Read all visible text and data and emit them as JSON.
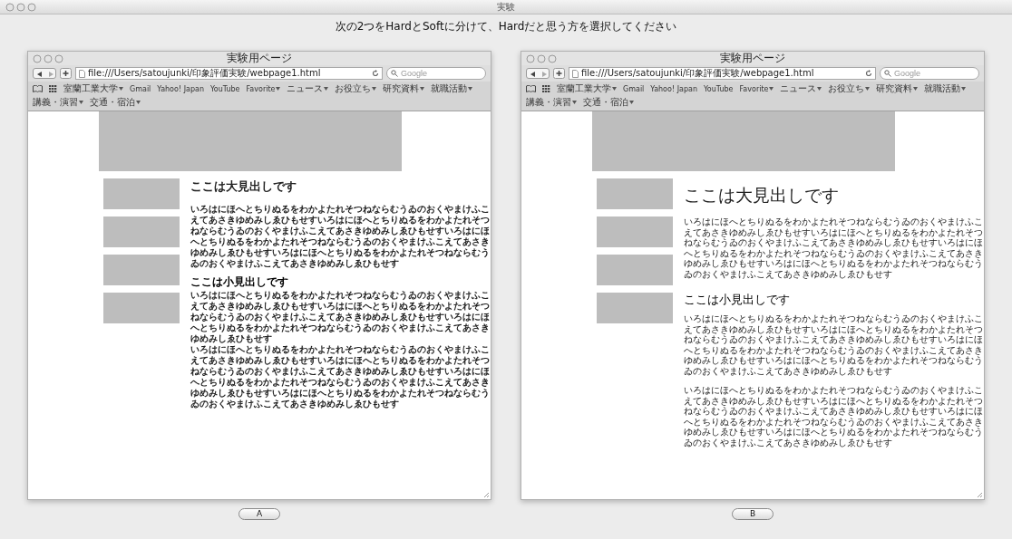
{
  "window": {
    "title": "実験"
  },
  "instruction": "次の2つをHardとSoftに分けて、Hardだと思う方を選択してください",
  "panes": [
    {
      "browser": {
        "title": "実験用ページ",
        "url": "file:///Users/satoujunki/印象評価実験/webpage1.html",
        "search": {
          "placeholder": "Google"
        },
        "bookmarks": [
          {
            "label": "室蘭工業大学",
            "menu": true
          },
          {
            "label": "Gmail",
            "menu": false
          },
          {
            "label": "Yahoo! Japan",
            "menu": false
          },
          {
            "label": "YouTube",
            "menu": false
          },
          {
            "label": "Favorite",
            "menu": true
          },
          {
            "label": "ニュース",
            "menu": true
          },
          {
            "label": "お役立ち",
            "menu": true
          },
          {
            "label": "研究資料",
            "menu": true
          },
          {
            "label": "就職活動",
            "menu": true
          },
          {
            "label": "講義・演習",
            "menu": true
          },
          {
            "label": "交通・宿泊",
            "menu": true
          }
        ]
      },
      "page": {
        "kind": "gothic",
        "blocks": [
          {
            "kind": "heading",
            "text": "ここは大見出しです"
          },
          {
            "kind": "paragraph",
            "text": "いろはにほへとちりぬるをわかよたれそつねならむうゐのおくやまけふこえてあさきゆめみしゑひもせすいろはにほへとちりぬるをわかよたれそつねならむうゐのおくやまけふこえてあさきゆめみしゑひもせすいろはにほへとちりぬるをわかよたれそつねならむうゐのおくやまけふこえてあさきゆめみしゑひもせすいろはにほへとちりぬるをわかよたれそつねならむうゐのおくやまけふこえてあさきゆめみしゑひもせす"
          },
          {
            "kind": "subheading",
            "text": "ここは小見出しです"
          },
          {
            "kind": "paragraph",
            "text": "いろはにほへとちりぬるをわかよたれそつねならむうゐのおくやまけふこえてあさきゆめみしゑひもせすいろはにほへとちりぬるをわかよたれそつねならむうゐのおくやまけふこえてあさきゆめみしゑひもせすいろはにほへとちりぬるをわかよたれそつねならむうゐのおくやまけふこえてあさきゆめみしゑひもせす"
          },
          {
            "kind": "paragraph",
            "text": "いろはにほへとちりぬるをわかよたれそつねならむうゐのおくやまけふこえてあさきゆめみしゑひもせすいろはにほへとちりぬるをわかよたれそつねならむうゐのおくやまけふこえてあさきゆめみしゑひもせすいろはにほへとちりぬるをわかよたれそつねならむうゐのおくやまけふこえてあさきゆめみしゑひもせすいろはにほへとちりぬるをわかよたれそつねならむうゐのおくやまけふこえてあさきゆめみしゑひもせす"
          }
        ]
      },
      "button": "A"
    },
    {
      "browser": {
        "title": "実験用ページ",
        "url": "file:///Users/satoujunki/印象評価実験/webpage1.html",
        "search": {
          "placeholder": "Google"
        },
        "bookmarks": [
          {
            "label": "室蘭工業大学",
            "menu": true
          },
          {
            "label": "Gmail",
            "menu": false
          },
          {
            "label": "Yahoo! Japan",
            "menu": false
          },
          {
            "label": "YouTube",
            "menu": false
          },
          {
            "label": "Favorite",
            "menu": true
          },
          {
            "label": "ニュース",
            "menu": true
          },
          {
            "label": "お役立ち",
            "menu": true
          },
          {
            "label": "研究資料",
            "menu": true
          },
          {
            "label": "就職活動",
            "menu": true
          },
          {
            "label": "講義・演習",
            "menu": true
          },
          {
            "label": "交通・宿泊",
            "menu": true
          }
        ]
      },
      "page": {
        "kind": "mincho",
        "blocks": [
          {
            "kind": "heading",
            "text": "ここは大見出しです"
          },
          {
            "kind": "paragraph",
            "text": "いろはにほへとちりぬるをわかよたれそつねならむうゐのおくやまけふこえてあさきゆめみしゑひもせすいろはにほへとちりぬるをわかよたれそつねならむうゐのおくやまけふこえてあさきゆめみしゑひもせすいろはにほへとちりぬるをわかよたれそつねならむうゐのおくやまけふこえてあさきゆめみしゑひもせすいろはにほへとちりぬるをわかよたれそつねならむうゐのおくやまけふこえてあさきゆめみしゑひもせす"
          },
          {
            "kind": "subheading",
            "text": "ここは小見出しです"
          },
          {
            "kind": "paragraph",
            "text": "いろはにほへとちりぬるをわかよたれそつねならむうゐのおくやまけふこえてあさきゆめみしゑひもせすいろはにほへとちりぬるをわかよたれそつねならむうゐのおくやまけふこえてあさきゆめみしゑひもせすいろはにほへとちりぬるをわかよたれそつねならむうゐのおくやまけふこえてあさきゆめみしゑひもせすいろはにほへとちりぬるをわかよたれそつねならむうゐのおくやまけふこえてあさきゆめみしゑひもせす"
          },
          {
            "kind": "paragraph",
            "text": "いろはにほへとちりぬるをわかよたれそつねならむうゐのおくやまけふこえてあさきゆめみしゑひもせすいろはにほへとちりぬるをわかよたれそつねならむうゐのおくやまけふこえてあさきゆめみしゑひもせすいろはにほへとちりぬるをわかよたれそつねならむうゐのおくやまけふこえてあさきゆめみしゑひもせすいろはにほへとちりぬるをわかよたれそつねならむうゐのおくやまけふこえてあさきゆめみしゑひもせす"
          }
        ]
      },
      "button": "B"
    }
  ]
}
